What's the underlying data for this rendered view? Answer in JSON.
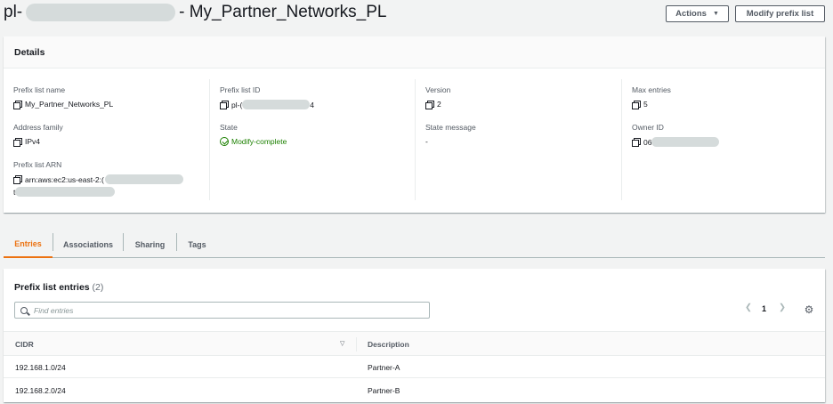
{
  "header": {
    "title_prefix": "pl-",
    "title_suffix": "- My_Partner_Networks_PL",
    "actions_label": "Actions",
    "modify_label": "Modify prefix list"
  },
  "details": {
    "heading": "Details",
    "prefix_list_name": {
      "label": "Prefix list name",
      "value": "My_Partner_Networks_PL"
    },
    "address_family": {
      "label": "Address family",
      "value": "IPv4"
    },
    "prefix_list_arn": {
      "label": "Prefix list ARN",
      "value_start": "arn:aws:ec2:us-east-2:(",
      "value_line2": "t"
    },
    "prefix_list_id": {
      "label": "Prefix list ID",
      "value_start": "pl-(",
      "value_end": "4"
    },
    "state": {
      "label": "State",
      "value": "Modify-complete"
    },
    "version": {
      "label": "Version",
      "value": "2"
    },
    "state_message": {
      "label": "State message",
      "value": "-"
    },
    "max_entries": {
      "label": "Max entries",
      "value": "5"
    },
    "owner_id": {
      "label": "Owner ID",
      "value_start": "06"
    }
  },
  "tabs": [
    "Entries",
    "Associations",
    "Sharing",
    "Tags"
  ],
  "entries": {
    "title": "Prefix list entries",
    "count": "(2)",
    "search_placeholder": "Find entries",
    "page": "1",
    "columns": [
      "CIDR",
      "Description"
    ],
    "rows": [
      {
        "cidr": "192.168.1.0/24",
        "description": "Partner-A"
      },
      {
        "cidr": "192.168.2.0/24",
        "description": "Partner-B"
      }
    ]
  },
  "colors": {
    "accent": "#ec7211",
    "success": "#1d8102",
    "text": "#16191f",
    "muted": "#545b64"
  }
}
